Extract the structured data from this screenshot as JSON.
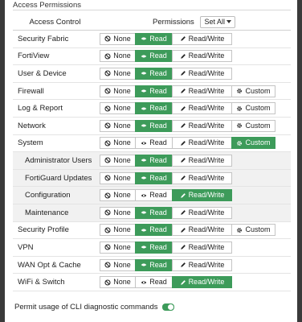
{
  "section": {
    "title": "Access Permissions"
  },
  "table": {
    "col_access": "Access Control",
    "col_permissions": "Permissions",
    "set_all": "Set All"
  },
  "labels": {
    "none": "None",
    "read": "Read",
    "rw": "Read/Write",
    "custom": "Custom"
  },
  "rows": [
    {
      "name": "Security Fabric",
      "active": "read",
      "custom": false,
      "sub": false
    },
    {
      "name": "FortiView",
      "active": "read",
      "custom": false,
      "sub": false
    },
    {
      "name": "User & Device",
      "active": "read",
      "custom": false,
      "sub": false
    },
    {
      "name": "Firewall",
      "active": "read",
      "custom": true,
      "sub": false
    },
    {
      "name": "Log & Report",
      "active": "read",
      "custom": true,
      "sub": false
    },
    {
      "name": "Network",
      "active": "read",
      "custom": true,
      "sub": false
    },
    {
      "name": "System",
      "active": "custom",
      "custom": true,
      "sub": false
    },
    {
      "name": "Administrator Users",
      "active": "read",
      "custom": false,
      "sub": true
    },
    {
      "name": "FortiGuard Updates",
      "active": "read",
      "custom": false,
      "sub": true
    },
    {
      "name": "Configuration",
      "active": "rw",
      "custom": false,
      "sub": true
    },
    {
      "name": "Maintenance",
      "active": "read",
      "custom": false,
      "sub": true
    },
    {
      "name": "Security Profile",
      "active": "read",
      "custom": true,
      "sub": false
    },
    {
      "name": "VPN",
      "active": "read",
      "custom": false,
      "sub": false
    },
    {
      "name": "WAN Opt & Cache",
      "active": "read",
      "custom": false,
      "sub": false
    },
    {
      "name": "WiFi & Switch",
      "active": "rw",
      "custom": false,
      "sub": false
    }
  ],
  "footer": {
    "cli_label": "Permit usage of CLI diagnostic commands",
    "cli_enabled": true
  },
  "colors": {
    "accent": "#3d9b5a",
    "page_bg": "#3a3a3a"
  }
}
